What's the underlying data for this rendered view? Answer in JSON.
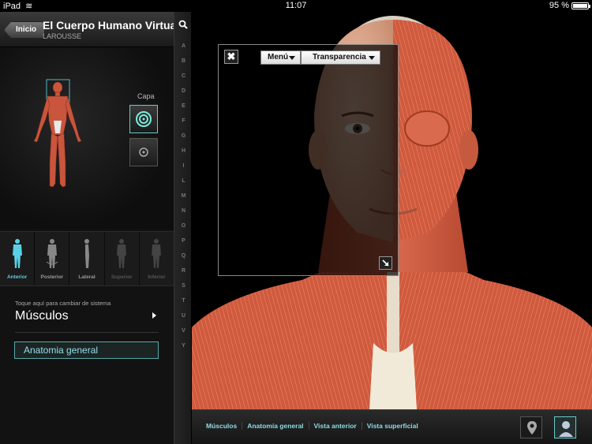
{
  "status_bar": {
    "device": "iPad",
    "time": "11:07",
    "battery": "95 %"
  },
  "header": {
    "back_label": "Inicio",
    "title": "El Cuerpo Humano Virtual",
    "subtitle": "LAROUSSE"
  },
  "layers": {
    "label": "Capa"
  },
  "views": [
    {
      "label": "Anterior",
      "state": "active"
    },
    {
      "label": "Posterior",
      "state": "normal"
    },
    {
      "label": "Lateral",
      "state": "normal"
    },
    {
      "label": "Superior",
      "state": "disabled"
    },
    {
      "label": "Inferior",
      "state": "disabled"
    }
  ],
  "system": {
    "hint": "Toque aquí para cambiar de sistema",
    "name": "Músculos"
  },
  "section": {
    "label": "Anatomia general"
  },
  "alphabet": [
    "A",
    "B",
    "C",
    "D",
    "E",
    "F",
    "G",
    "H",
    "I",
    "L",
    "M",
    "N",
    "O",
    "P",
    "Q",
    "R",
    "S",
    "T",
    "U",
    "V",
    "Y"
  ],
  "overlay": {
    "menu_label": "Menú",
    "transparency_label": "Transparencia"
  },
  "breadcrumbs": [
    "Músculos",
    "Anatomía general",
    "Vista anterior",
    "Vista superficial"
  ],
  "colors": {
    "accent": "#5ad0e6",
    "muscle": "#c9553c",
    "skin": "#e8b49a"
  }
}
